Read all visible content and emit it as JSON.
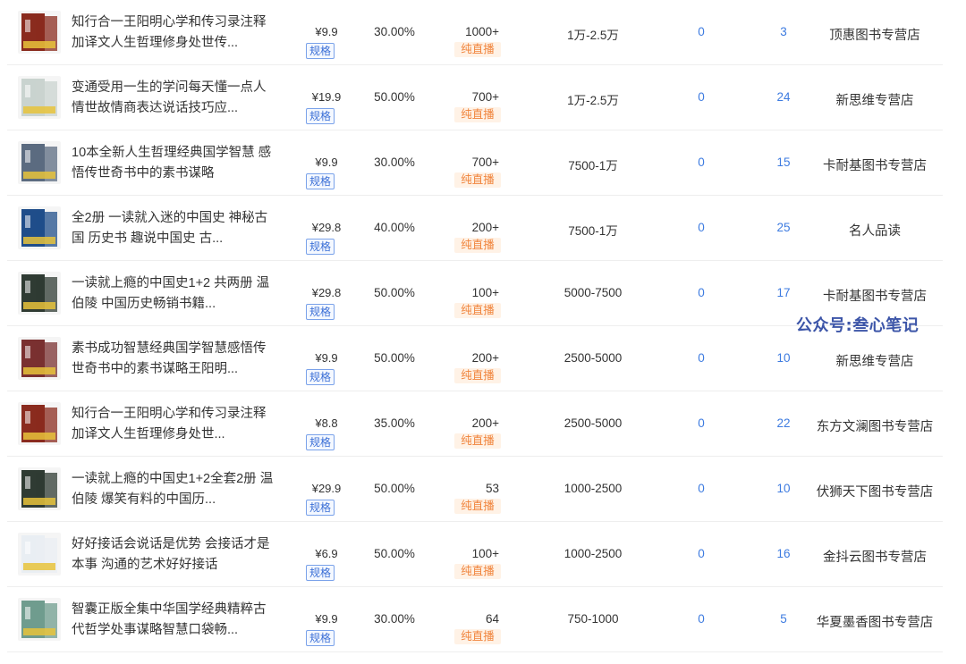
{
  "rows": [
    {
      "title": "知行合一王阳明心学和传习录注释加译文人生哲理修身处世传...",
      "price": "¥9.9",
      "spec": "规格",
      "rate": "30.00%",
      "sales": "1000+",
      "tag": "纯直播",
      "gmv": "1万-2.5万",
      "c1": "0",
      "c2": "3",
      "shop": "顶惠图书专营店",
      "thumb_color": "#8a2b1e"
    },
    {
      "title": "变通受用一生的学问每天懂一点人情世故情商表达说话技巧应...",
      "price": "¥19.9",
      "spec": "规格",
      "rate": "50.00%",
      "sales": "700+",
      "tag": "纯直播",
      "gmv": "1万-2.5万",
      "c1": "0",
      "c2": "24",
      "shop": "新思维专营店",
      "thumb_color": "#c9d3cf"
    },
    {
      "title": "10本全新人生哲理经典国学智慧 感悟传世奇书中的素书谋略",
      "price": "¥9.9",
      "spec": "规格",
      "rate": "30.00%",
      "sales": "700+",
      "tag": "纯直播",
      "gmv": "7500-1万",
      "c1": "0",
      "c2": "15",
      "shop": "卡耐基图书专营店",
      "thumb_color": "#5b6b80"
    },
    {
      "title": "全2册 一读就入迷的中国史 神秘古国 历史书 趣说中国史 古...",
      "price": "¥29.8",
      "spec": "规格",
      "rate": "40.00%",
      "sales": "200+",
      "tag": "纯直播",
      "gmv": "7500-1万",
      "c1": "0",
      "c2": "25",
      "shop": "名人品读",
      "thumb_color": "#1f4d8a"
    },
    {
      "title": "一读就上瘾的中国史1+2 共两册 温伯陵 中国历史畅销书籍...",
      "price": "¥29.8",
      "spec": "规格",
      "rate": "50.00%",
      "sales": "100+",
      "tag": "纯直播",
      "gmv": "5000-7500",
      "c1": "0",
      "c2": "17",
      "shop": "卡耐基图书专营店",
      "thumb_color": "#2f3b33"
    },
    {
      "title": "素书成功智慧经典国学智慧感悟传世奇书中的素书谋略王阳明...",
      "price": "¥9.9",
      "spec": "规格",
      "rate": "50.00%",
      "sales": "200+",
      "tag": "纯直播",
      "gmv": "2500-5000",
      "c1": "0",
      "c2": "10",
      "shop": "新思维专营店",
      "thumb_color": "#7a3030"
    },
    {
      "title": "知行合一王阳明心学和传习录注释加译文人生哲理修身处世...",
      "price": "¥8.8",
      "spec": "规格",
      "rate": "35.00%",
      "sales": "200+",
      "tag": "纯直播",
      "gmv": "2500-5000",
      "c1": "0",
      "c2": "22",
      "shop": "东方文澜图书专营店",
      "thumb_color": "#8a2b1e"
    },
    {
      "title": "一读就上瘾的中国史1+2全套2册 温伯陵 爆笑有料的中国历...",
      "price": "¥29.9",
      "spec": "规格",
      "rate": "50.00%",
      "sales": "53",
      "tag": "纯直播",
      "gmv": "1000-2500",
      "c1": "0",
      "c2": "10",
      "shop": "伏狮天下图书专营店",
      "thumb_color": "#2f3b33"
    },
    {
      "title": "好好接话会说话是优势 会接话才是本事 沟通的艺术好好接话",
      "price": "¥6.9",
      "spec": "规格",
      "rate": "50.00%",
      "sales": "100+",
      "tag": "纯直播",
      "gmv": "1000-2500",
      "c1": "0",
      "c2": "16",
      "shop": "金抖云图书专营店",
      "thumb_color": "#e9eef3"
    },
    {
      "title": "智囊正版全集中华国学经典精粹古代哲学处事谋略智慧口袋畅...",
      "price": "¥9.9",
      "spec": "规格",
      "rate": "30.00%",
      "sales": "64",
      "tag": "纯直播",
      "gmv": "750-1000",
      "c1": "0",
      "c2": "5",
      "shop": "华夏墨香图书专营店",
      "thumb_color": "#6f9c8e"
    }
  ],
  "watermark": "公众号:叁心笔记"
}
